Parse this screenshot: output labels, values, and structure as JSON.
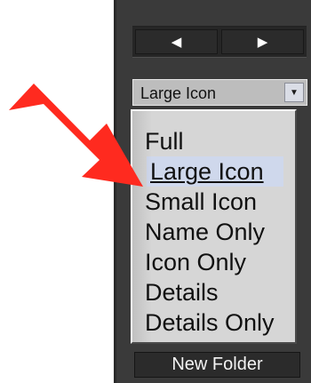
{
  "navigation": {
    "back_label": "◀",
    "forward_label": "▶"
  },
  "view_selector": {
    "selected_value": "Large Icon",
    "arrow_icon": "▼"
  },
  "dropdown": {
    "options": [
      "Full",
      "Large Icon",
      "Small Icon",
      "Name Only",
      "Icon Only",
      "Details",
      "Details Only"
    ]
  },
  "actions": {
    "new_folder_label": "New Folder"
  },
  "annotation": {
    "pointer_color": "#ff2a1f",
    "pointer_icon": "red-arrow-icon"
  }
}
